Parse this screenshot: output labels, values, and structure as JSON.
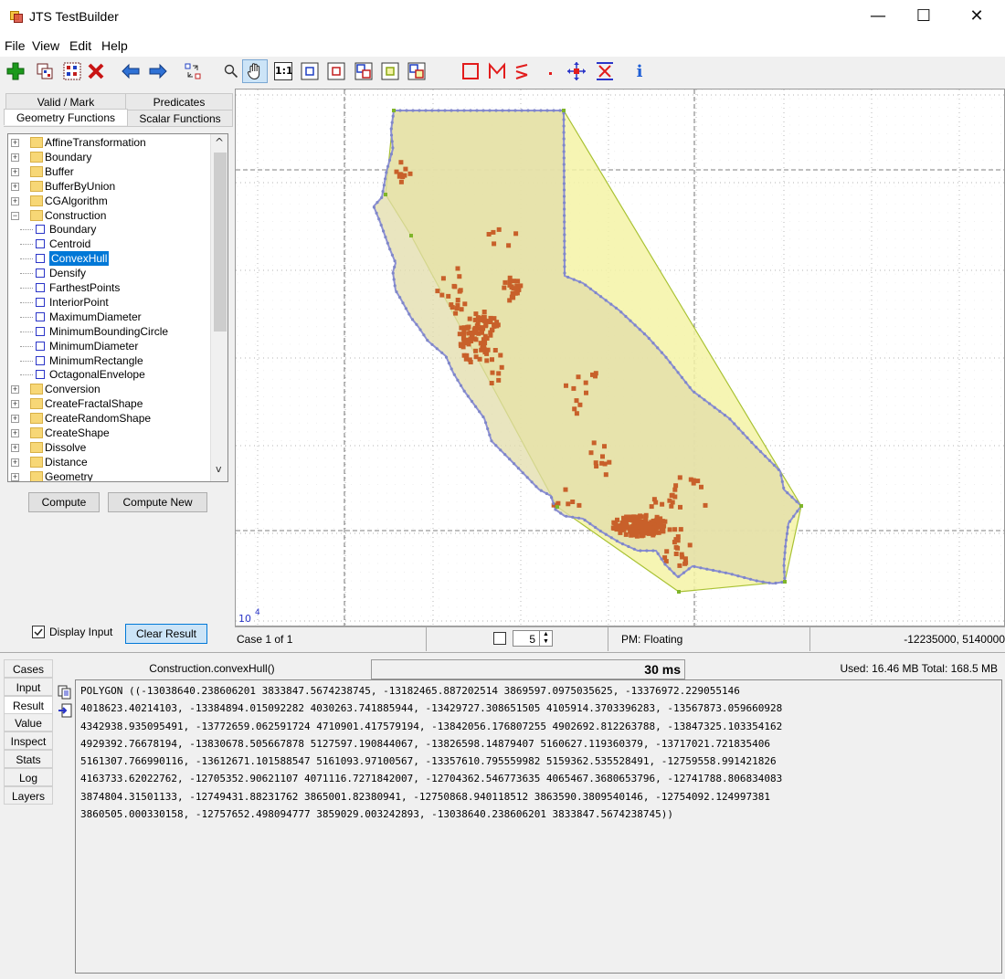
{
  "window": {
    "title": "JTS TestBuilder",
    "minimize": "—",
    "maximize": "☐",
    "close": "✕"
  },
  "menu": [
    "File",
    "View",
    "Edit",
    "Help"
  ],
  "toolbar": {
    "buttons": [
      "add-case",
      "copy-case",
      "paste-case",
      "delete-case",
      "previous-case",
      "next-case",
      "exchange-geometries",
      "zoom",
      "pan",
      "zoom-1-1",
      "zoom-input-a",
      "zoom-input-b",
      "zoom-result",
      "zoom-spatial-function",
      "zoom-all",
      "draw-polygon",
      "draw-linestring",
      "draw-line",
      "draw-point",
      "edit-vertex",
      "extract-component",
      "info"
    ],
    "one_to_one": "1:1",
    "info": "i"
  },
  "left_panel": {
    "tabs_row1": [
      "Valid / Mark",
      "Predicates"
    ],
    "tabs_row2": [
      "Geometry Functions",
      "Scalar Functions"
    ],
    "tree": [
      {
        "label": "AffineTransformation",
        "type": "folder"
      },
      {
        "label": "Boundary",
        "type": "folder"
      },
      {
        "label": "Buffer",
        "type": "folder"
      },
      {
        "label": "BufferByUnion",
        "type": "folder"
      },
      {
        "label": "CGAlgorithm",
        "type": "folder"
      },
      {
        "label": "Construction",
        "type": "folder-open"
      },
      {
        "label": "Boundary",
        "type": "leaf"
      },
      {
        "label": "Centroid",
        "type": "leaf"
      },
      {
        "label": "ConvexHull",
        "type": "leaf",
        "selected": true
      },
      {
        "label": "Densify",
        "type": "leaf"
      },
      {
        "label": "FarthestPoints",
        "type": "leaf"
      },
      {
        "label": "InteriorPoint",
        "type": "leaf"
      },
      {
        "label": "MaximumDiameter",
        "type": "leaf"
      },
      {
        "label": "MinimumBoundingCircle",
        "type": "leaf"
      },
      {
        "label": "MinimumDiameter",
        "type": "leaf"
      },
      {
        "label": "MinimumRectangle",
        "type": "leaf"
      },
      {
        "label": "OctagonalEnvelope",
        "type": "leaf"
      },
      {
        "label": "Conversion",
        "type": "folder"
      },
      {
        "label": "CreateFractalShape",
        "type": "folder"
      },
      {
        "label": "CreateRandomShape",
        "type": "folder"
      },
      {
        "label": "CreateShape",
        "type": "folder"
      },
      {
        "label": "Dissolve",
        "type": "folder"
      },
      {
        "label": "Distance",
        "type": "folder"
      },
      {
        "label": "Geometry",
        "type": "folder"
      }
    ],
    "compute": "Compute",
    "compute_new": "Compute New",
    "display_input": "Display Input",
    "clear_result": "Clear Result"
  },
  "map": {
    "scale_label": "10",
    "scale_exp": "4",
    "colors": {
      "hull_fill": "#f4f3a6",
      "hull_stroke": "#a9c234",
      "input_fill": "#e2dcaa",
      "input_stroke": "#8d90d4",
      "points": "#c8602a",
      "grid": "#c8c8c8"
    }
  },
  "status": {
    "case": "Case 1 of 1",
    "spinner_value": "5",
    "pm": "PM: Floating",
    "coords": "-12235000, 5140000"
  },
  "bottom": {
    "side_tabs": [
      "Cases",
      "Input",
      "Result",
      "Value",
      "Inspect",
      "Stats",
      "Log",
      "Layers"
    ],
    "active_tab": "Result",
    "function_name": "Construction.convexHull()",
    "time": "30 ms",
    "memory": "Used: 16.46 MB   Total: 168.5 MB",
    "wkt_lines": [
      "POLYGON ((-13038640.238606201 3833847.5674238745, -13182465.887202514 3869597.0975035625, -13376972.229055146",
      "4018623.40214103, -13384894.015092282 4030263.741885944, -13429727.308651505 4105914.3703396283, -13567873.059660928",
      "4342938.935095491, -13772659.062591724 4710901.417579194, -13842056.176807255 4902692.812263788, -13847325.103354162",
      "4929392.76678194, -13830678.505667878 5127597.190844067, -13826598.14879407 5160627.119360379, -13717021.721835406",
      "5161307.766990116, -13612671.101588547 5161093.97100567, -13357610.795559982 5159362.535528491, -12759558.991421826",
      "4163733.62022762, -12705352.90621107 4071116.7271842007, -12704362.546773635 4065467.3680653796, -12741788.806834083",
      "3874804.31501133, -12749431.88231762 3865001.82380941, -12750868.940118512 3863590.3809540146, -12754092.124997381",
      "3860505.000330158, -12757652.498094777 3859029.003242893, -13038640.238606201 3833847.5674238745))"
    ]
  }
}
